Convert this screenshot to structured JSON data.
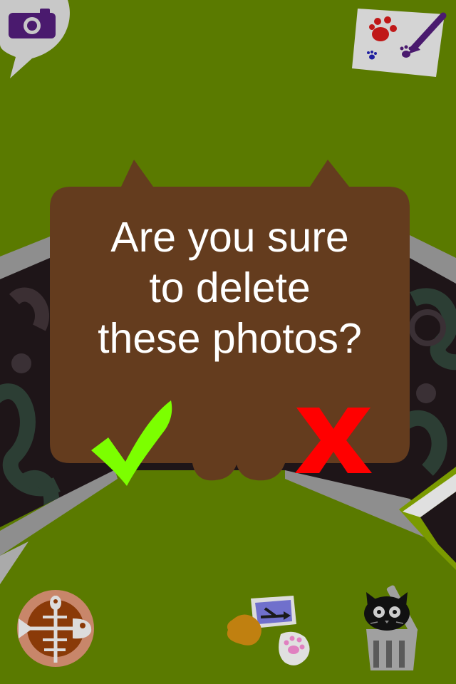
{
  "dialog": {
    "message_line1": "Are you sure",
    "message_line2": "to delete",
    "message_line3": "these photos?"
  },
  "icons": {
    "top_left": "camera-icon",
    "top_right": "paint-paper-icon",
    "bottom_left": "fishbone-icon",
    "bottom_center": "photo-share-icon",
    "bottom_right": "cat-trash-icon",
    "confirm": "checkmark-icon",
    "cancel": "cross-icon"
  },
  "colors": {
    "background": "#5a7a00",
    "dialog": "#643c1e",
    "confirm": "#7cff00",
    "cancel": "#ff0000",
    "frame": "#8e8e8e"
  }
}
